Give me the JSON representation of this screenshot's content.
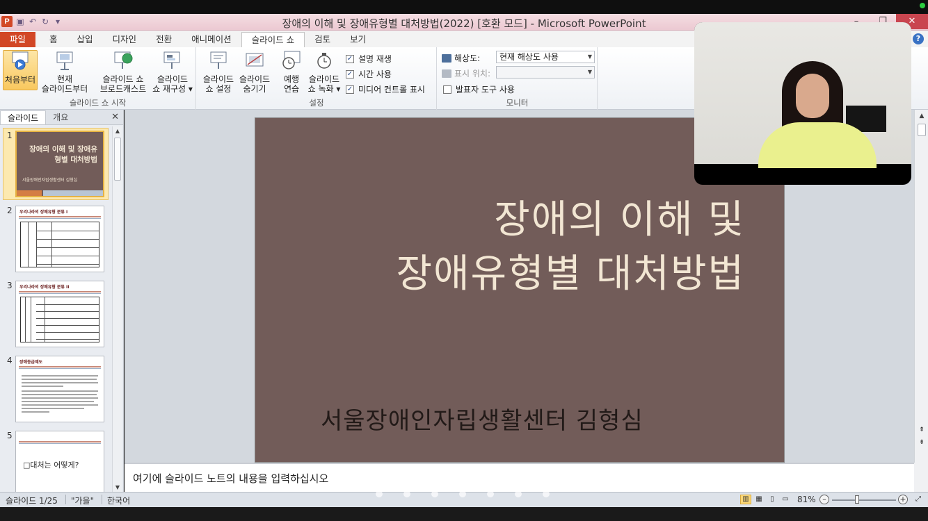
{
  "window": {
    "title": "장애의 이해 및 장애유형별 대처방법(2022) [호환 모드] - Microsoft PowerPoint",
    "logo": "P"
  },
  "tabs": [
    "파일",
    "홈",
    "삽입",
    "디자인",
    "전환",
    "애니메이션",
    "슬라이드 쇼",
    "검토",
    "보기"
  ],
  "active_tab": "슬라이드 쇼",
  "ribbon": {
    "start_group": {
      "label": "슬라이드 쇼 시작",
      "from_beginning": "처음부터",
      "from_current_1": "현재",
      "from_current_2": "슬라이드부터",
      "broadcast_1": "슬라이드 쇼",
      "broadcast_2": "브로드캐스트",
      "custom_1": "슬라이드",
      "custom_2": "쇼 재구성"
    },
    "setup_group": {
      "label": "설정",
      "setup_1": "슬라이드",
      "setup_2": "쇼 설정",
      "hide_1": "슬라이드",
      "hide_2": "숨기기",
      "rehearse_1": "예행",
      "rehearse_2": "연습",
      "record_1": "슬라이드",
      "record_2": "쇼 녹화",
      "play_narrations": "설명 재생",
      "use_timings": "시간 사용",
      "show_media_controls": "미디어 컨트롤 표시"
    },
    "monitors_group": {
      "label": "모니터",
      "resolution_label": "해상도:",
      "resolution_value": "현재 해상도 사용",
      "show_on_label": "표시 위치:",
      "show_on_value": "",
      "presenter_view": "발표자 도구 사용"
    }
  },
  "left_panel": {
    "tabs": [
      "슬라이드",
      "개요"
    ],
    "thumbnails": [
      {
        "num": "1",
        "title": "장애의 이해 및 장애유형별 대처방법",
        "sub": "서울장애인자립생활센터 김형심"
      },
      {
        "num": "2",
        "title": "우리나라의 장애유형 분류 I"
      },
      {
        "num": "3",
        "title": "우리나라의 장애유형 분류 II"
      },
      {
        "num": "4",
        "title": "장애등급제도"
      },
      {
        "num": "5",
        "title": "□대처는 어떻게?"
      }
    ]
  },
  "slide": {
    "title_line1": "장애의 이해 및",
    "title_line2": "장애유형별 대처방법",
    "subtitle": "서울장애인자립생활센터 김형심",
    "bg_color": "#725c59",
    "title_color": "#f2e6d3"
  },
  "notes_placeholder": "여기에 슬라이드 노트의 내용을 입력하십시오",
  "status": {
    "slide_counter": "슬라이드 1/25",
    "theme": "\"가을\"",
    "language": "한국어",
    "zoom": "81%"
  }
}
